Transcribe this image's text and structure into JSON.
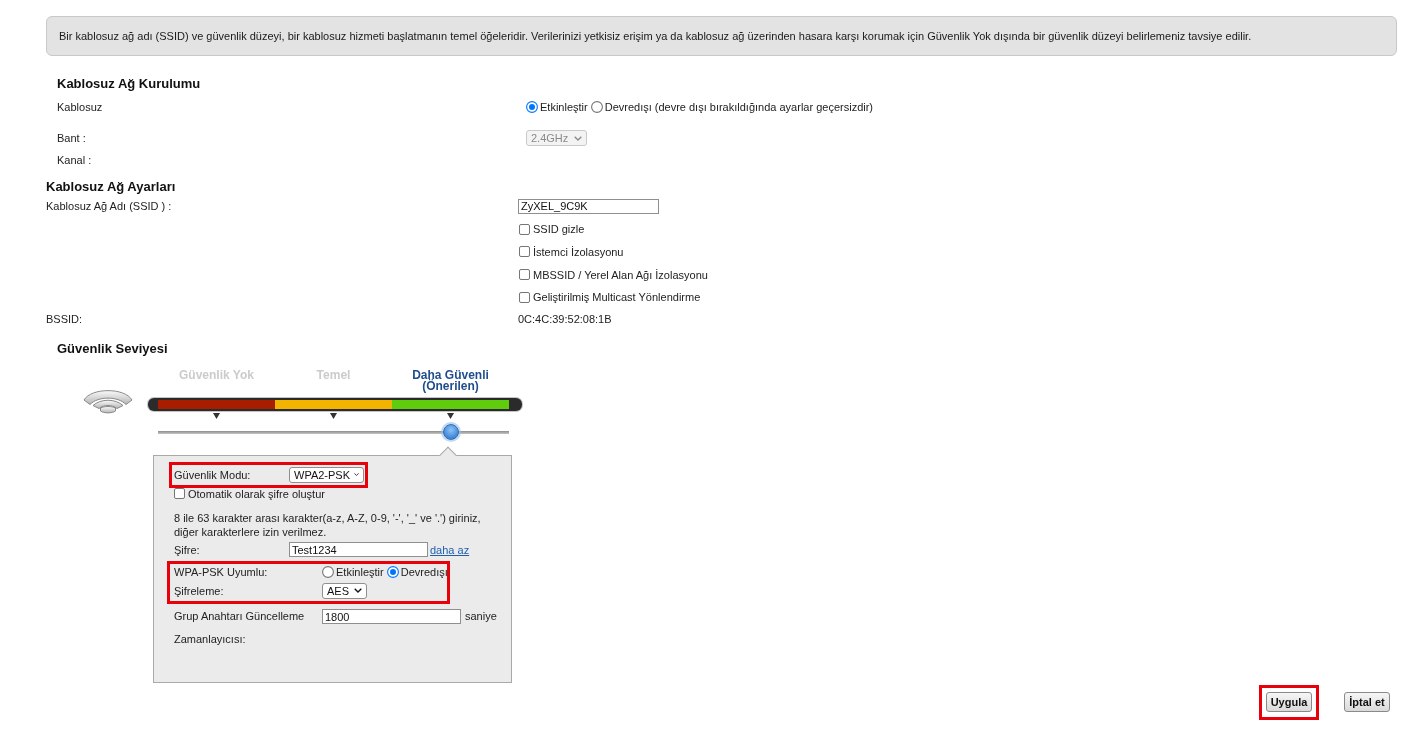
{
  "notice": "Bir kablosuz ağ adı (SSID) ve güvenlik düzeyi, bir kablosuz hizmeti başlatmanın temel öğeleridir. Verilerinizi yetkisiz erişim ya da kablosuz ağ üzerinden hasara karşı korumak için Güvenlik Yok dışında bir güvenlik düzeyi belirlemeniz tavsiye edilir.",
  "wireless_setup": {
    "title": "Kablosuz Ağ Kurulumu",
    "rows": [
      {
        "kind": "radio",
        "label": "Kablosuz",
        "options": [
          {
            "label": "Etkinleştir",
            "selected": true
          },
          {
            "label": "Devredışı",
            "selected": false
          }
        ],
        "note": "(devre dışı bırakıldığında ayarlar geçersizdir)"
      },
      {
        "kind": "select",
        "label": "Bant :",
        "value": "2.4GHz",
        "disabled": true
      },
      {
        "kind": "plain",
        "label": "Kanal :"
      }
    ]
  },
  "wireless_settings": {
    "title": "Kablosuz Ağ Ayarları",
    "ssid": {
      "label": "Kablosuz Ağ Adı (SSID ) :",
      "value": "ZyXEL_9C9K"
    },
    "checkboxes": [
      {
        "label": "SSID gizle",
        "checked": false
      },
      {
        "label": "İstemci İzolasyonu",
        "checked": false
      },
      {
        "label": "MBSSID / Yerel Alan Ağı İzolasyonu",
        "checked": false
      },
      {
        "label": "Geliştirilmiş Multicast Yönlendirme",
        "checked": false
      }
    ],
    "bssid": {
      "label": "BSSID:",
      "value": "0C:4C:39:52:08:1B"
    }
  },
  "security_level": {
    "title": "Güvenlik Seviyesi",
    "levels": [
      {
        "label": "Güvenlik Yok",
        "selected": false,
        "color": "#a81c00"
      },
      {
        "label": "Temel",
        "selected": false,
        "color": "#f2b400"
      },
      {
        "label": "Daha Güvenli (Önerilen)",
        "selected": true,
        "color": "#5fcc0e"
      }
    ]
  },
  "security_panel": {
    "mode": {
      "label": "Güvenlik Modu:",
      "value": "WPA2-PSK",
      "highlighted": true
    },
    "auto_password": {
      "label": "Otomatik olarak şifre oluştur",
      "checked": false
    },
    "hint": "8 ile 63 karakter arası karakter(a-z, A-Z, 0-9, '-', '_' ve '.') giriniz, diğer karakterlere izin verilmez.",
    "password": {
      "label": "Şifre:",
      "value": "Test1234",
      "link": "daha az"
    },
    "compat_group": {
      "highlighted": true,
      "wpa_psk": {
        "label": "WPA-PSK Uyumlu:",
        "options": [
          {
            "label": "Etkinleştir",
            "selected": false
          },
          {
            "label": "Devredışı",
            "selected": true
          }
        ]
      },
      "encryption": {
        "label": "Şifreleme:",
        "value": "AES"
      }
    },
    "group_key": {
      "label": "Grup Anahtarı Güncelleme Zamanlayıcısı:",
      "value": "1800",
      "unit": "saniye"
    }
  },
  "buttons": [
    {
      "label": "Uygula",
      "highlighted": true
    },
    {
      "label": "İptal et",
      "highlighted": false
    }
  ]
}
